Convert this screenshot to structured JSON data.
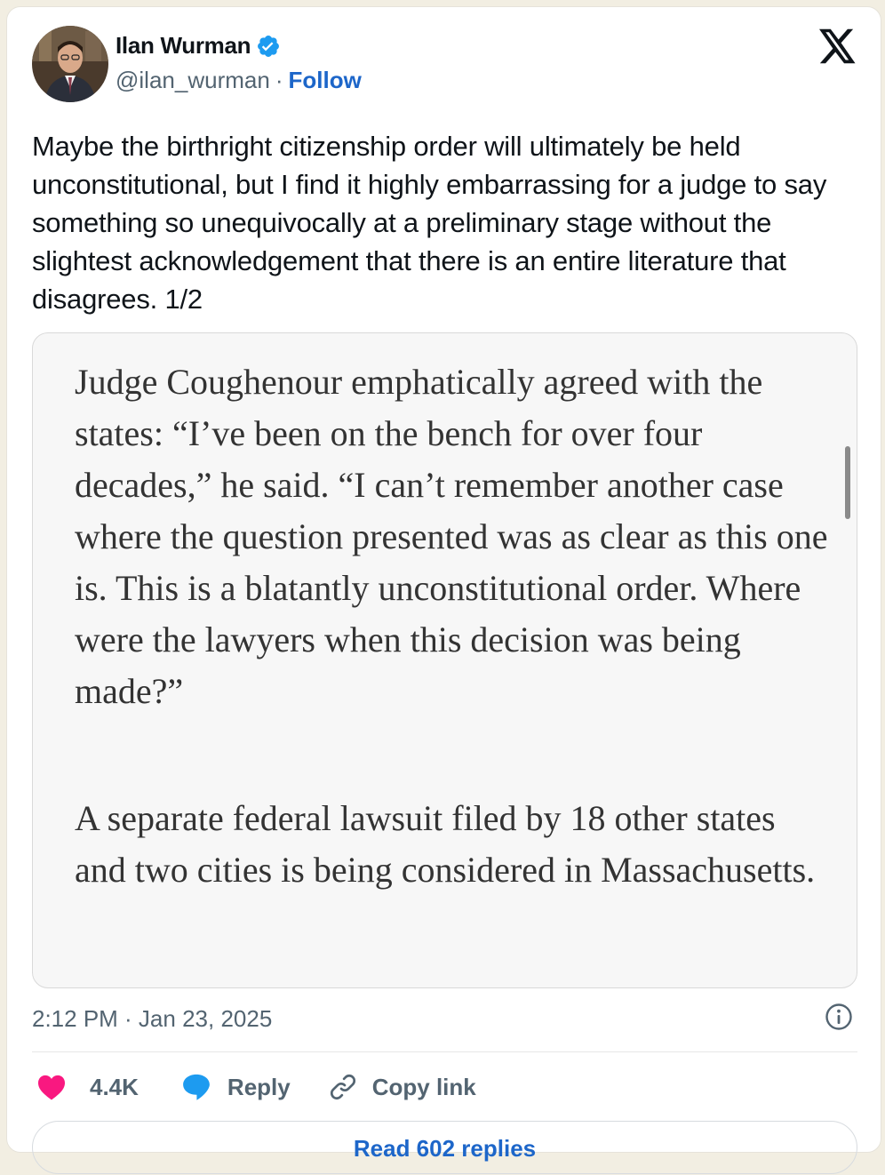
{
  "author": {
    "display_name": "Ilan Wurman",
    "handle": "@ilan_wurman",
    "separator": "·",
    "follow_label": "Follow",
    "verified": true
  },
  "tweet": {
    "text": "Maybe the birthright citizenship order will ultimately be held unconstitutional, but I find it highly embarrassing for a judge to say something so unequivocally at a preliminary stage without the slightest acknowledgement that there is an entire literature that disagrees. 1/2",
    "timestamp": "2:12 PM · Jan 23, 2025"
  },
  "media": {
    "paragraph_1": "Judge Coughenour emphatically agreed with the states: “I’ve been on the bench for over four decades,” he said. “I can’t remember another case where the question presented was as clear as this one is. This is a blatantly unconstitutional order. Where were the lawyers when this decision was being made?”",
    "paragraph_2": "A separate federal lawsuit filed by 18 other states and two cities is being considered in Massachusetts."
  },
  "actions": {
    "likes_count": "4.4K",
    "reply_label": "Reply",
    "copy_link_label": "Copy link"
  },
  "footer": {
    "read_replies_label": "Read 602 replies"
  },
  "colors": {
    "accent": "#1d66c9",
    "like": "#f91880",
    "reply_bubble": "#1d9bf0",
    "verified": "#1d9bf0"
  }
}
